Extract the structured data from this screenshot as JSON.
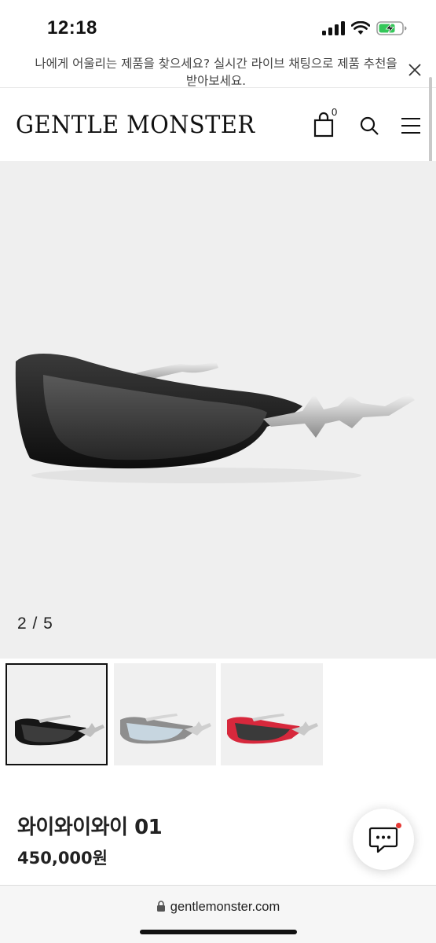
{
  "status_bar": {
    "time": "12:18"
  },
  "banner": {
    "text": "나에게 어울리는 제품을 찾으세요? 실시간 라이브 채팅으로 제품 추천을 받아보세요."
  },
  "header": {
    "brand": "GENTLE MONSTER",
    "cart_count": "0"
  },
  "gallery": {
    "counter": "2 / 5",
    "current_slide": 2,
    "total_slides": 5
  },
  "thumbnails": [
    {
      "name": "black",
      "selected": true
    },
    {
      "name": "silver",
      "selected": false
    },
    {
      "name": "red",
      "selected": false
    }
  ],
  "product": {
    "name": "와이와이와이 01",
    "price": "450,000원"
  },
  "browser": {
    "url": "gentlemonster.com"
  },
  "icons": [
    "cart-icon",
    "search-icon",
    "menu-icon",
    "close-icon",
    "chat-icon",
    "lock-icon"
  ],
  "colors": {
    "notification_dot": "#e53935",
    "hero_bg": "#efefef"
  }
}
